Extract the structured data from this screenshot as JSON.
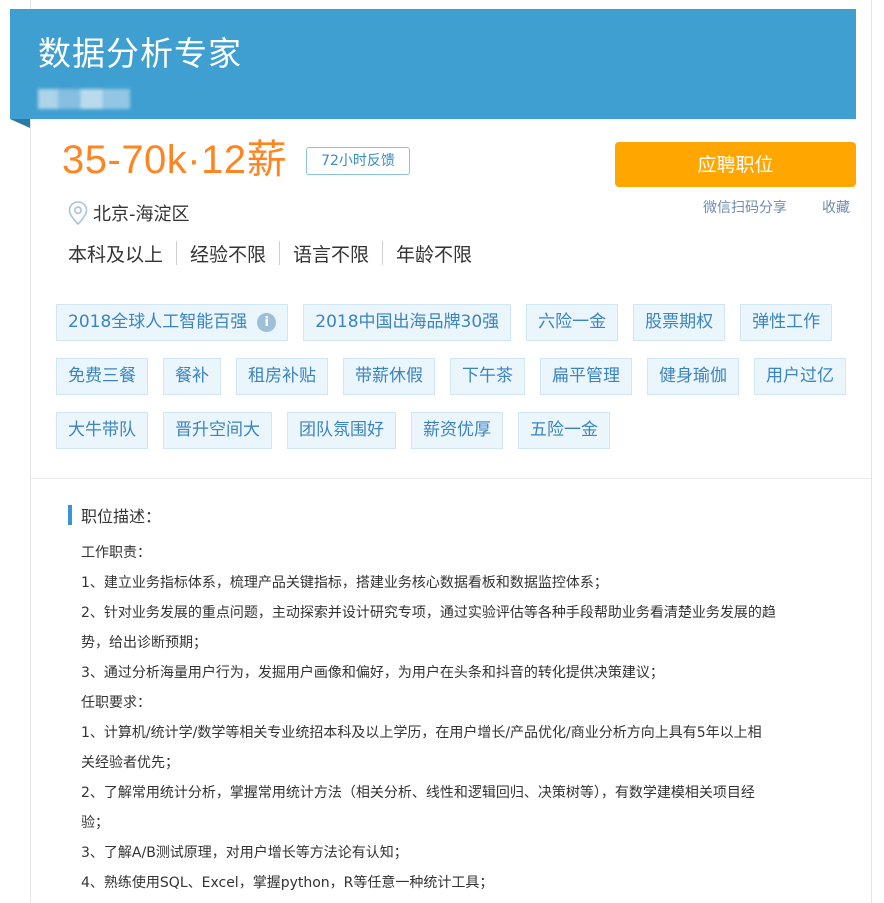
{
  "job": {
    "title": "数据分析专家",
    "salary": "35-70k·12薪",
    "feedback_badge": "72小时反馈",
    "location": "北京-海淀区",
    "requirements": [
      "本科及以上",
      "经验不限",
      "语言不限",
      "年龄不限"
    ]
  },
  "actions": {
    "apply_label": "应聘职位",
    "share_label": "微信扫码分享",
    "collect_label": "收藏"
  },
  "tags": [
    [
      "2018全球人工智能百强",
      "2018中国出海品牌30强",
      "六险一金",
      "股票期权",
      "弹性工作"
    ],
    [
      "免费三餐",
      "餐补",
      "租房补贴",
      "带薪休假",
      "下午茶",
      "扁平管理",
      "健身瑜伽",
      "用户过亿"
    ],
    [
      "大牛带队",
      "晋升空间大",
      "团队氛围好",
      "薪资优厚",
      "五险一金"
    ]
  ],
  "description": {
    "title": "职位描述：",
    "lines": [
      "工作职责：",
      "1、建立业务指标体系，梳理产品关键指标，搭建业务核心数据看板和数据监控体系；",
      "2、针对业务发展的重点问题，主动探索并设计研究专项，通过实验评估等各种手段帮助业务看清楚业务发展的趋",
      "势，给出诊断预期；",
      "3、通过分析海量用户行为，发掘用户画像和偏好，为用户在头条和抖音的转化提供决策建议；",
      "任职要求：",
      "1、计算机/统计学/数学等相关专业统招本科及以上学历，在用户增长/产品优化/商业分析方向上具有5年以上相",
      "关经验者优先；",
      "2、了解常用统计分析，掌握常用统计方法（相关分析、线性和逻辑回归、决策树等），有数学建模相关项目经",
      "验；",
      "3、了解A/B测试原理，对用户增长等方法论有认知；",
      "4、熟练使用SQL、Excel，掌握python，R等任意一种统计工具；"
    ]
  },
  "icons": {
    "location": "location-pin-icon",
    "info": "info-icon"
  },
  "colors": {
    "banner": "#3f9fd0",
    "salary": "#fd8522",
    "apply": "#ffa600",
    "tag_text": "#3b84bf"
  }
}
